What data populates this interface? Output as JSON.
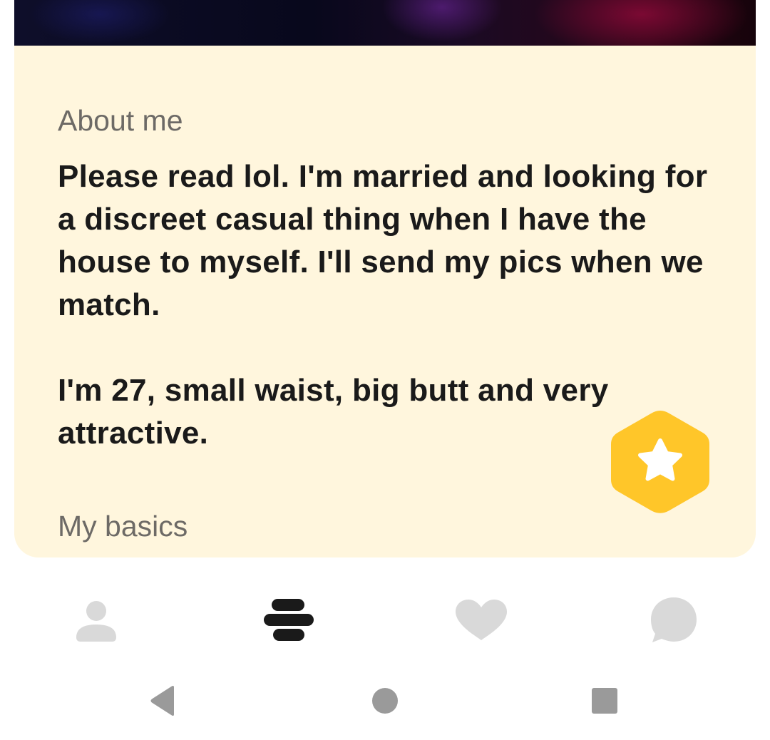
{
  "profile": {
    "about_title": "About me",
    "about_text": "Please read lol. I'm married and looking for a discreet casual thing when I have the house to myself. I'll send my pics when we match.\n\nI'm 27, small waist, big butt and very attractive.",
    "basics_title": "My basics",
    "superswipe_icon": "star-icon"
  },
  "tabs": [
    {
      "icon": "profile-icon",
      "active": false
    },
    {
      "icon": "discover-icon",
      "active": true
    },
    {
      "icon": "heart-icon",
      "active": false
    },
    {
      "icon": "chat-bubble-icon",
      "active": false
    }
  ],
  "system_nav": [
    "back-icon",
    "home-icon",
    "recents-icon"
  ],
  "colors": {
    "card_background": "#fff6dd",
    "accent_yellow": "#ffc629",
    "text_primary": "#1a1a1a",
    "text_secondary": "#6d6a66",
    "icon_inactive": "#d9d9d9",
    "icon_active": "#1a1a1a",
    "nav_icon": "#9a9a9a"
  }
}
